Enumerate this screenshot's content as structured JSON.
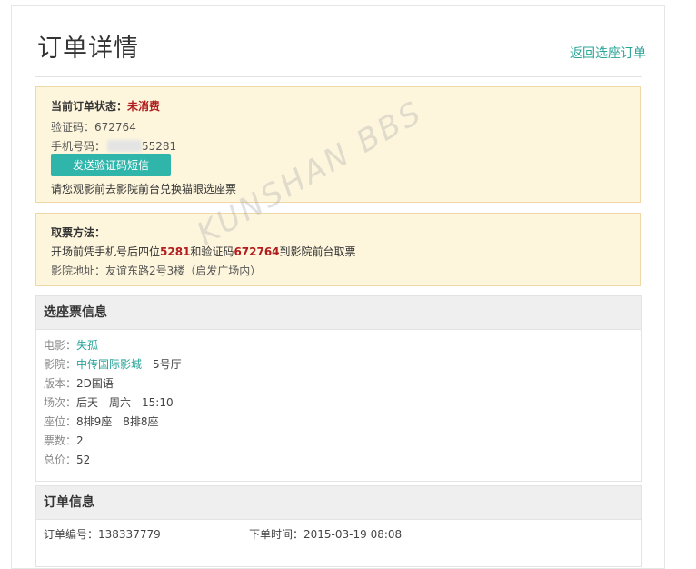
{
  "page": {
    "title": "订单详情",
    "back_link": "返回选座订单"
  },
  "status_box": {
    "status_label": "当前订单状态：",
    "status_value": "未消费",
    "code_label": "验证码：",
    "code_value": "672764",
    "phone_label": "手机号码：",
    "phone_value": "55281",
    "send_button": "发送验证码短信",
    "hint": "请您观影前去影院前台兑换猫眼选座票"
  },
  "pickup_box": {
    "title": "取票方法：",
    "line1_prefix": "开场前凭手机号后四位",
    "line1_digits": "5281",
    "line1_mid": "和验证码",
    "line1_code": "672764",
    "line1_suffix": "到影院前台取票",
    "address_label": "影院地址：",
    "address_value": "友谊东路2号3楼（启发广场内）"
  },
  "seat_panel": {
    "title": "选座票信息",
    "rows": [
      {
        "label": "电影：",
        "value": "失孤",
        "is_link": true
      },
      {
        "label": "影院：",
        "value": "中传国际影城",
        "extra": "5号厅",
        "is_link": true
      },
      {
        "label": "版本：",
        "value": "2D国语"
      },
      {
        "label": "场次：",
        "value": "后天　周六　15:10"
      },
      {
        "label": "座位：",
        "value": "8排9座　8排8座"
      },
      {
        "label": "票数：",
        "value": "2"
      },
      {
        "label": "总价：",
        "value": "52"
      }
    ]
  },
  "order_panel": {
    "title": "订单信息",
    "order_no_label": "订单编号：",
    "order_no_value": "138337779",
    "order_time_label": "下单时间：",
    "order_time_value": "2015-03-19 08:08"
  },
  "watermark": "KUNSHAN BBS",
  "colors": {
    "accent": "#2aa59a",
    "button": "#2fb5aa",
    "notice_bg": "#fdf6dd",
    "notice_border": "#f0d7a6",
    "alert_red": "#b11c1c"
  }
}
